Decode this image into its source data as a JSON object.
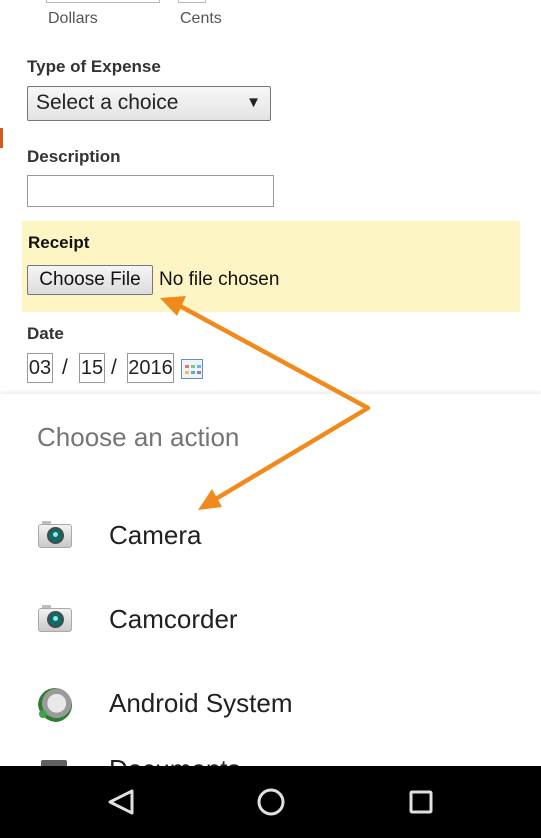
{
  "form": {
    "amount_sublabels": {
      "dollars": "Dollars",
      "cents": "Cents"
    },
    "type_of_expense": {
      "label": "Type of Expense",
      "selected": "Select a choice"
    },
    "description": {
      "label": "Description",
      "value": ""
    },
    "receipt": {
      "label": "Receipt",
      "button": "Choose File",
      "status": "No file chosen",
      "highlight_color": "#fdf5c4"
    },
    "date": {
      "label": "Date",
      "month": "03",
      "day": "15",
      "year": "2016",
      "separator": "/"
    }
  },
  "action_sheet": {
    "title": "Choose an action",
    "actions": [
      {
        "label": "Camera",
        "icon": "camera-icon"
      },
      {
        "label": "Camcorder",
        "icon": "camcorder-icon"
      },
      {
        "label": "Android System",
        "icon": "android-system-icon"
      },
      {
        "label": "Documents",
        "icon": "documents-icon"
      }
    ]
  },
  "navbar": {
    "buttons": [
      "back-icon",
      "home-icon",
      "recents-icon"
    ]
  },
  "colors": {
    "annotation_arrow": "#f08a1c",
    "navbar": "#000000"
  }
}
